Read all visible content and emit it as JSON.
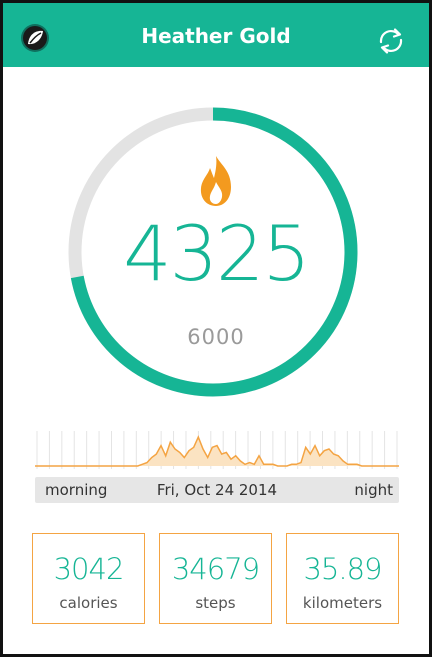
{
  "header": {
    "user_name": "Heather Gold",
    "logo_icon": "leaf-logo-icon",
    "sync_icon": "refresh-icon",
    "brand_color": "#16b595"
  },
  "progress": {
    "steps": "4325",
    "goal": "6000",
    "fraction": 0.7208,
    "ring_color": "#16b595",
    "track_color": "#e3e3e3",
    "flame_color": "#f39a1f"
  },
  "timeline": {
    "start_label": "morning",
    "date": "Fri, Oct 24 2014",
    "end_label": "night"
  },
  "activity": {
    "line_color": "#f4a443",
    "levels": [
      0,
      0,
      0,
      0,
      0,
      0,
      0,
      0,
      0,
      0,
      0,
      0,
      0,
      0,
      0,
      0,
      0,
      0,
      0,
      0,
      0,
      0,
      0,
      0.05,
      0.1,
      0.25,
      0.35,
      0.6,
      0.3,
      0.7,
      0.5,
      0.4,
      0.25,
      0.45,
      0.55,
      0.85,
      0.5,
      0.25,
      0.55,
      0.6,
      0.35,
      0.4,
      0.2,
      0.3,
      0.15,
      0.05,
      0.1,
      0.05,
      0.3,
      0.05,
      0.05,
      0.05,
      0,
      0,
      0,
      0.05,
      0.05,
      0.1,
      0.55,
      0.35,
      0.6,
      0.3,
      0.45,
      0.5,
      0.35,
      0.3,
      0.15,
      0.05,
      0.05,
      0.05,
      0,
      0,
      0,
      0,
      0,
      0,
      0,
      0,
      0
    ]
  },
  "stats": [
    {
      "value": "3042",
      "label": "calories"
    },
    {
      "value": "34679",
      "label": "steps"
    },
    {
      "value": "35.89",
      "label": "kilometers"
    }
  ]
}
